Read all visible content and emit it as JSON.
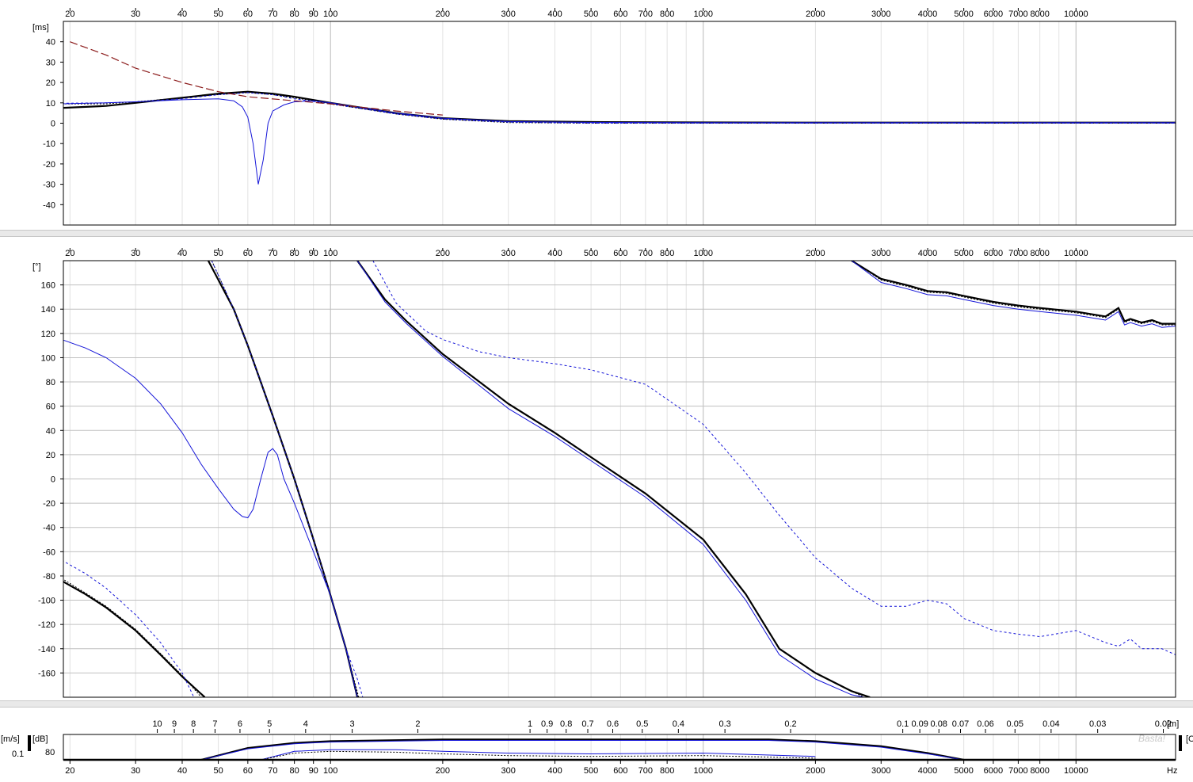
{
  "freq_ticks": [
    "20",
    "30",
    "40",
    "50",
    "60",
    "70",
    "80",
    "90",
    "100",
    "200",
    "300",
    "400",
    "500",
    "600",
    "700",
    "800",
    "1000",
    "2000",
    "3000",
    "4000",
    "5000",
    "6000",
    "7000",
    "8000",
    "10000"
  ],
  "freq_tick_values": [
    20,
    30,
    40,
    50,
    60,
    70,
    80,
    90,
    100,
    200,
    300,
    400,
    500,
    600,
    700,
    800,
    1000,
    2000,
    3000,
    4000,
    5000,
    6000,
    7000,
    8000,
    10000
  ],
  "wavelength_ticks": [
    "10",
    "9",
    "8",
    "7",
    "6",
    "5",
    "4",
    "3",
    "2",
    "1",
    "0.9",
    "0.8",
    "0.7",
    "0.6",
    "0.5",
    "0.4",
    "0.3",
    "0.2",
    "0.1",
    "0.09",
    "0.08",
    "0.07",
    "0.06",
    "0.05",
    "0.04",
    "0.03",
    "0.02"
  ],
  "wavelength_tick_values": [
    10,
    9,
    8,
    7,
    6,
    5,
    4,
    3,
    2,
    1,
    0.9,
    0.8,
    0.7,
    0.6,
    0.5,
    0.4,
    0.3,
    0.2,
    0.1,
    0.09,
    0.08,
    0.07,
    0.06,
    0.05,
    0.04,
    0.03,
    0.02
  ],
  "colors": {
    "black": "#000000",
    "blue": "#1515d8",
    "darkred": "#8b1a1a",
    "grid": "#c0c0c0",
    "gridminor": "#e2e2e2"
  },
  "chart_data": [
    {
      "type": "line",
      "id": "group-delay",
      "ylabel": "[ms]",
      "x_scale": "log",
      "xlim": [
        19.2,
        18500
      ],
      "ylim": [
        -50,
        50
      ],
      "ytick_labels": [
        "40",
        "30",
        "20",
        "10",
        "0",
        "-10",
        "-20",
        "-30",
        "-40"
      ],
      "ytick_values": [
        40,
        30,
        20,
        10,
        0,
        -10,
        -20,
        -30,
        -40
      ],
      "series": [
        {
          "style": "black-thick",
          "x": [
            19,
            25,
            30,
            40,
            50,
            60,
            70,
            80,
            100,
            150,
            200,
            300,
            500,
            1000,
            2000,
            5000,
            10000,
            18500
          ],
          "y": [
            7.5,
            8.5,
            10,
            12.5,
            14.5,
            15.5,
            14.5,
            13,
            10,
            5,
            2.5,
            1,
            0.6,
            0.4,
            0.3,
            0.3,
            0.3,
            0.3
          ]
        },
        {
          "style": "black-dotted",
          "x": [
            19,
            25,
            30,
            40,
            50,
            60,
            70,
            80,
            100,
            150,
            200,
            300,
            500,
            1000,
            2000,
            5000,
            10000,
            18500
          ],
          "y": [
            9.5,
            9.5,
            10.5,
            12.5,
            14,
            15,
            14,
            12.5,
            9.5,
            4.5,
            2,
            0.3,
            0,
            0,
            0,
            0,
            0,
            0
          ]
        },
        {
          "style": "blue-thin",
          "x": [
            19,
            25,
            30,
            40,
            50,
            55,
            58,
            60,
            62,
            64,
            66,
            68,
            70,
            75,
            80,
            90,
            100,
            150,
            200,
            300,
            500,
            1000,
            2000,
            5000,
            10000,
            18500
          ],
          "y": [
            9.5,
            10,
            10.5,
            11.5,
            12,
            11,
            8,
            3,
            -10,
            -30,
            -18,
            0,
            6,
            9,
            10.5,
            11,
            10,
            5,
            2.5,
            0.8,
            0.4,
            0.3,
            0.3,
            0.3,
            0.3,
            0.3
          ]
        },
        {
          "style": "blue-dashed",
          "x": [
            19,
            25,
            30,
            40,
            50,
            60,
            70,
            80,
            100,
            150,
            200,
            300,
            500,
            1000,
            2000,
            5000,
            10000,
            18500
          ],
          "y": [
            9.8,
            10,
            10.5,
            12,
            14,
            15,
            14,
            12,
            9.5,
            4.5,
            2,
            0.5,
            0,
            0,
            0,
            0,
            0,
            0
          ]
        },
        {
          "style": "darkred-dashed",
          "x": [
            20,
            25,
            30,
            40,
            50,
            60,
            80,
            100,
            150,
            200
          ],
          "y": [
            40,
            33.5,
            27,
            20,
            15.5,
            13,
            11,
            9.5,
            6,
            4
          ]
        }
      ]
    },
    {
      "type": "line",
      "id": "phase",
      "ylabel": "[°]",
      "x_scale": "log",
      "xlim": [
        19.2,
        18500
      ],
      "ylim": [
        -180,
        180
      ],
      "ytick_labels": [
        "160",
        "140",
        "120",
        "100",
        "80",
        "60",
        "40",
        "20",
        "0",
        "-20",
        "-40",
        "-60",
        "-80",
        "-100",
        "-120",
        "-140",
        "-160"
      ],
      "ytick_values": [
        160,
        140,
        120,
        100,
        80,
        60,
        40,
        20,
        0,
        -20,
        -40,
        -60,
        -80,
        -100,
        -120,
        -140,
        -160
      ],
      "series": [
        {
          "style": "black-thick",
          "segments": [
            {
              "x": [
                19,
                22,
                25,
                30,
                35,
                40,
                46
              ],
              "y": [
                -84,
                -95,
                -106,
                -125,
                -145,
                -163,
                -180
              ]
            },
            {
              "x": [
                47,
                55,
                60,
                65,
                70,
                80,
                90,
                100,
                110,
                118
              ],
              "y": [
                180,
                140,
                110,
                80,
                52,
                0,
                -50,
                -96,
                -140,
                -180
              ]
            },
            {
              "x": [
                118,
                140,
                160,
                200,
                300,
                400,
                500,
                700,
                1000,
                1300,
                1600,
                2000,
                2500,
                2800
              ],
              "y": [
                180,
                148,
                130,
                103,
                62,
                38,
                18,
                -12,
                -50,
                -95,
                -140,
                -160,
                -175,
                -180
              ]
            },
            {
              "x": [
                2500,
                3000,
                3500,
                4000,
                4500,
                5000,
                6000,
                7000,
                8000,
                10000,
                12000,
                13000,
                13500,
                14000,
                15000,
                16000,
                17000,
                18500
              ],
              "y": [
                180,
                165,
                160,
                155,
                154,
                151,
                146,
                143,
                141,
                138,
                134,
                141,
                130,
                132,
                129,
                131,
                128,
                128
              ]
            }
          ]
        },
        {
          "style": "black-dotted",
          "segments": [
            {
              "x": [
                19,
                22,
                25,
                30,
                35,
                40,
                45
              ],
              "y": [
                -82,
                -94,
                -105,
                -124,
                -144,
                -162,
                -180
              ]
            },
            {
              "x": [
                48,
                55,
                60,
                65,
                70,
                80,
                90,
                100,
                110,
                119
              ],
              "y": [
                180,
                140,
                110,
                80,
                52,
                0,
                -50,
                -96,
                -140,
                -180
              ]
            },
            {
              "x": [
                118,
                140,
                160,
                200,
                300,
                400,
                500,
                700,
                1000,
                1300,
                1600,
                2000,
                2500,
                2700
              ],
              "y": [
                180,
                148,
                130,
                103,
                62,
                38,
                18,
                -12,
                -50,
                -95,
                -140,
                -160,
                -175,
                -180
              ]
            },
            {
              "x": [
                2500,
                3000,
                3500,
                4000,
                4500,
                5000,
                6000,
                7000,
                8000,
                10000,
                12000,
                13000,
                13500,
                14000,
                15000,
                16000,
                17000,
                18500
              ],
              "y": [
                180,
                164,
                159,
                154,
                153,
                150,
                145,
                142,
                140,
                137,
                133,
                140,
                129,
                131,
                128,
                130,
                127,
                127
              ]
            }
          ]
        },
        {
          "style": "blue-thin",
          "segments": [
            {
              "x": [
                19,
                22,
                25,
                30,
                35,
                40,
                45,
                50,
                55,
                58,
                60,
                62,
                65,
                68,
                70,
                72,
                75,
                80,
                90,
                100,
                110,
                118
              ],
              "y": [
                115,
                108,
                100,
                83,
                62,
                38,
                12,
                -8,
                -25,
                -31,
                -32,
                -25,
                0,
                22,
                25,
                20,
                0,
                -20,
                -60,
                -96,
                -140,
                -180
              ]
            },
            {
              "x": [
                118,
                140,
                160,
                200,
                300,
                400,
                500,
                700,
                1000,
                1300,
                1600,
                2000,
                2500,
                2700
              ],
              "y": [
                180,
                146,
                128,
                101,
                58,
                35,
                15,
                -15,
                -54,
                -100,
                -145,
                -165,
                -178,
                -180
              ]
            },
            {
              "x": [
                2500,
                3000,
                3500,
                4000,
                4500,
                5000,
                6000,
                7000,
                8000,
                10000,
                12000,
                13000,
                13500,
                14000,
                15000,
                16000,
                17000,
                18500
              ],
              "y": [
                180,
                162,
                157,
                152,
                151,
                148,
                143,
                140,
                138,
                135,
                131,
                138,
                127,
                129,
                126,
                128,
                125,
                126
              ]
            }
          ]
        },
        {
          "style": "blue-dashed",
          "segments": [
            {
              "x": [
                19,
                22,
                25,
                30,
                35,
                40,
                43
              ],
              "y": [
                -67,
                -78,
                -90,
                -112,
                -135,
                -160,
                -180
              ]
            },
            {
              "x": [
                48,
                55,
                60,
                65,
                70,
                80,
                90,
                100,
                110,
                118,
                122
              ],
              "y": [
                180,
                140,
                110,
                80,
                52,
                0,
                -50,
                -96,
                -140,
                -165,
                -180
              ]
            },
            {
              "x": [
                130,
                150,
                180,
                200,
                250,
                300,
                400,
                500,
                700,
                1000,
                1300,
                1600,
                2000,
                2500,
                3000,
                3500,
                4000,
                4500,
                5000,
                6000,
                7000,
                8000,
                10000,
                12000,
                13000,
                14000,
                15000,
                16000,
                17000,
                18500
              ],
              "y": [
                180,
                145,
                122,
                115,
                105,
                100,
                95,
                90,
                78,
                45,
                5,
                -30,
                -65,
                -90,
                -105,
                -105,
                -100,
                -103,
                -115,
                -125,
                -128,
                -130,
                -125,
                -135,
                -138,
                -132,
                -140,
                -140,
                -140,
                -145
              ]
            }
          ]
        }
      ]
    },
    {
      "type": "line",
      "id": "magnitude-strip",
      "ylabel_left": "[m/s]",
      "ylabel_right": "[dB]",
      "unit_right": "[m]",
      "xlabel": "Hz",
      "clipped_right_label": "[C",
      "ytick_left": "0.1",
      "ytick_right": "80",
      "x_scale": "log",
      "xlim": [
        19.2,
        18500
      ],
      "ylim": [
        75,
        90
      ],
      "series": [
        {
          "style": "black-thick",
          "x": [
            45,
            60,
            80,
            100,
            200,
            500,
            1000,
            1500,
            2000,
            3000,
            4000,
            5000
          ],
          "y": [
            75,
            82,
            85,
            86,
            87,
            87,
            87,
            87,
            86,
            83,
            79,
            75
          ]
        },
        {
          "style": "blue-thin",
          "x": [
            45,
            60,
            80,
            100,
            200,
            500,
            1000,
            1500,
            2000,
            3000,
            4000,
            5000
          ],
          "y": [
            75,
            81.5,
            84.5,
            85.5,
            86.5,
            86.5,
            86.5,
            86.5,
            85.5,
            82.5,
            78.5,
            75
          ]
        },
        {
          "style": "blue-thin",
          "x": [
            65,
            80,
            100,
            150,
            200,
            300,
            500,
            1000,
            2000
          ],
          "y": [
            75,
            80,
            81,
            81,
            80,
            79,
            78.5,
            79,
            77
          ]
        },
        {
          "style": "black-dotted",
          "x": [
            65,
            80,
            100,
            150,
            200,
            300,
            500,
            1000,
            2000
          ],
          "y": [
            75,
            79,
            80,
            79.5,
            78.5,
            77.5,
            77,
            77.5,
            76
          ]
        }
      ]
    }
  ],
  "watermark": "Basta!"
}
